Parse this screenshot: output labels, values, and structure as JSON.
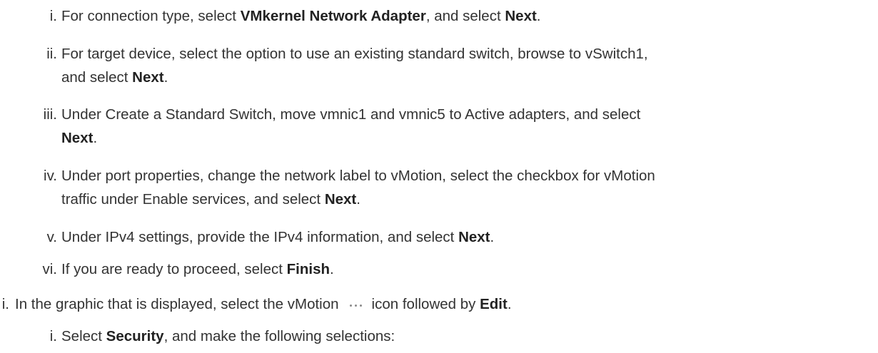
{
  "steps": [
    {
      "number": "i.",
      "lines": [
        {
          "parts": [
            {
              "t": "For connection type, select ",
              "b": false
            },
            {
              "t": "VMkernel Network Adapter",
              "b": true
            },
            {
              "t": ", and select ",
              "b": false
            },
            {
              "t": "Next",
              "b": true
            },
            {
              "t": ".",
              "b": false
            }
          ]
        }
      ]
    },
    {
      "number": "ii.",
      "lines": [
        {
          "parts": [
            {
              "t": "For target device, select the option to use an existing standard switch, browse to vSwitch1,",
              "b": false
            }
          ]
        },
        {
          "parts": [
            {
              "t": "and select ",
              "b": false
            },
            {
              "t": "Next",
              "b": true
            },
            {
              "t": ".",
              "b": false
            }
          ]
        }
      ]
    },
    {
      "number": "iii.",
      "lines": [
        {
          "parts": [
            {
              "t": "Under Create a Standard Switch, move vmnic1 and vmnic5 to Active adapters, and select",
              "b": false
            }
          ]
        },
        {
          "parts": [
            {
              "t": "Next",
              "b": true
            },
            {
              "t": ".",
              "b": false
            }
          ]
        }
      ]
    },
    {
      "number": "iv.",
      "lines": [
        {
          "parts": [
            {
              "t": "Under port properties, change the network label to vMotion, select the checkbox for vMotion",
              "b": false
            }
          ]
        },
        {
          "parts": [
            {
              "t": "traffic under Enable services, and select ",
              "b": false
            },
            {
              "t": "Next",
              "b": true
            },
            {
              "t": ".",
              "b": false
            }
          ]
        }
      ]
    },
    {
      "number": "v.",
      "lines": [
        {
          "parts": [
            {
              "t": "Under IPv4 settings, provide the IPv4 information, and select ",
              "b": false
            },
            {
              "t": "Next",
              "b": true
            },
            {
              "t": ".",
              "b": false
            }
          ]
        }
      ]
    },
    {
      "number": "vi.",
      "lines": [
        {
          "parts": [
            {
              "t": "If you are ready to proceed, select ",
              "b": false
            },
            {
              "t": "Finish",
              "b": true
            },
            {
              "t": ".",
              "b": false
            }
          ]
        }
      ]
    }
  ],
  "outer_step": {
    "number": "i.",
    "text_before_icon": "In the graphic that is displayed, select the vMotion",
    "icon": "ellipsis-icon",
    "text_after_icon": "icon followed by ",
    "bold": "Edit",
    "end": "."
  },
  "sub_step": {
    "number": "i.",
    "text_before": "Select ",
    "bold": "Security",
    "text_after": ", and make the following selections:"
  }
}
